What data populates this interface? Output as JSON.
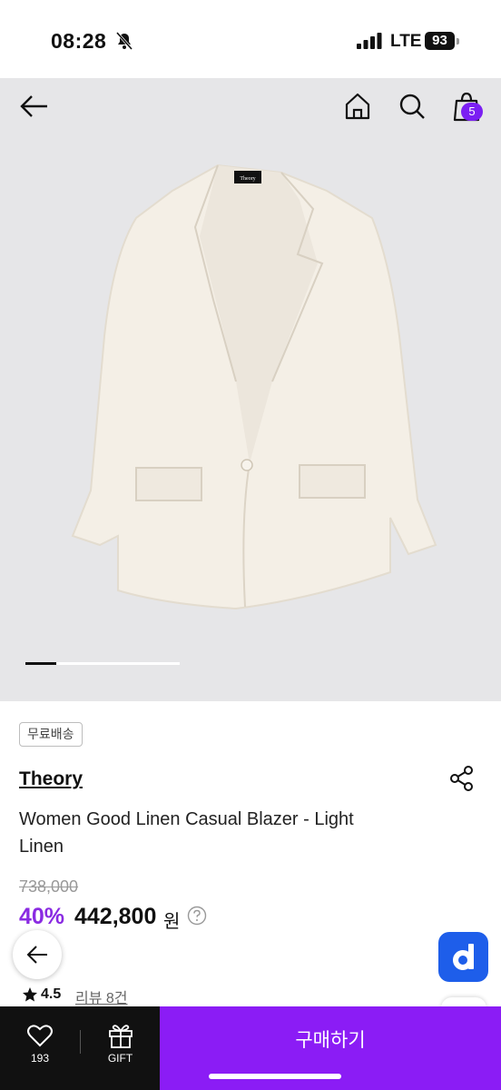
{
  "status": {
    "time": "08:28",
    "network": "LTE",
    "battery": "93"
  },
  "nav": {
    "cart_count": "5"
  },
  "product": {
    "jacket_tag": "Theory",
    "badge": "무료배송",
    "brand": "Theory",
    "title": "Women Good Linen Casual Blazer - Light Linen",
    "original_price": "738,000",
    "discount": "40%",
    "sale_price": "442,800",
    "currency": "원",
    "rating": "4.5",
    "reviews": "리뷰 8건"
  },
  "bottom": {
    "likes": "193",
    "gift_label": "GIFT",
    "buy_label": "구매하기"
  },
  "colors": {
    "accent": "#8b1cf5",
    "discount": "#8a2be2",
    "d_button": "#1e5eea"
  }
}
